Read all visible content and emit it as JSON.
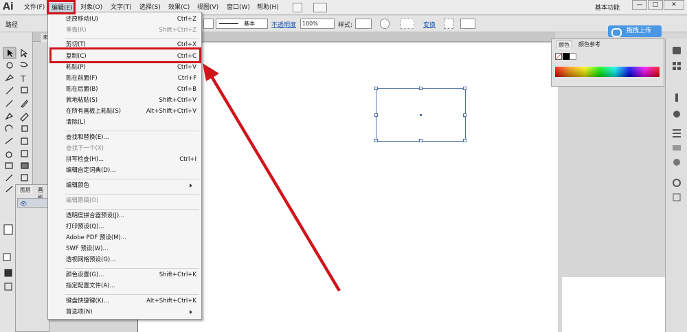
{
  "app": {
    "logo": "Ai"
  },
  "menubar": {
    "items": [
      "文件(F)",
      "编辑(E)",
      "对象(O)",
      "文字(T)",
      "选择(S)",
      "效果(C)",
      "视图(V)",
      "窗口(W)",
      "帮助(H)"
    ],
    "workspace": "基本功能",
    "window_buttons": [
      "—",
      "□",
      "✕"
    ]
  },
  "controlbar": {
    "label": "路径",
    "stroke_style": "基本",
    "opacity_link": "不透明度",
    "opacity_value": "100%",
    "style_label": "样式:",
    "transform_link": "变换"
  },
  "upload_button": "拖拽上传",
  "document": {
    "tab": "未"
  },
  "layers_panel": {
    "tabs": [
      "图层",
      "画板"
    ]
  },
  "color_panel": {
    "tabs": [
      "颜色",
      "颜色参考"
    ],
    "accent": "#4a97e5"
  },
  "edit_menu": {
    "items": [
      {
        "label": "还原移动(U)",
        "shortcut": "Ctrl+Z",
        "disabled": false
      },
      {
        "label": "重做(R)",
        "shortcut": "Shift+Ctrl+Z",
        "disabled": true
      },
      {
        "label": "剪切(T)",
        "shortcut": "Ctrl+X",
        "disabled": false
      },
      {
        "label": "复制(C)",
        "shortcut": "Ctrl+C",
        "disabled": false,
        "highlighted": true
      },
      {
        "label": "粘贴(P)",
        "shortcut": "Ctrl+V",
        "disabled": false
      },
      {
        "label": "贴在前面(F)",
        "shortcut": "Ctrl+F",
        "disabled": false
      },
      {
        "label": "贴在后面(B)",
        "shortcut": "Ctrl+B",
        "disabled": false
      },
      {
        "label": "就地粘贴(S)",
        "shortcut": "Shift+Ctrl+V",
        "disabled": false
      },
      {
        "label": "在所有画板上粘贴(S)",
        "shortcut": "Alt+Shift+Ctrl+V",
        "disabled": false
      },
      {
        "label": "清除(L)",
        "shortcut": "",
        "disabled": false
      },
      {
        "label": "查找和替换(E)...",
        "shortcut": "",
        "disabled": false
      },
      {
        "label": "查找下一个(X)",
        "shortcut": "",
        "disabled": true
      },
      {
        "label": "拼写检查(H)...",
        "shortcut": "Ctrl+I",
        "disabled": false
      },
      {
        "label": "编辑自定词典(D)...",
        "shortcut": "",
        "disabled": false
      },
      {
        "label": "编辑颜色",
        "shortcut": "",
        "disabled": false,
        "submenu": true
      },
      {
        "label": "编辑原稿(O)",
        "shortcut": "",
        "disabled": true
      },
      {
        "label": "透明度拼合器预设(J)...",
        "shortcut": "",
        "disabled": false
      },
      {
        "label": "打印预设(Q)...",
        "shortcut": "",
        "disabled": false
      },
      {
        "label": "Adobe PDF 预设(M)...",
        "shortcut": "",
        "disabled": false
      },
      {
        "label": "SWF 预设(W)...",
        "shortcut": "",
        "disabled": false
      },
      {
        "label": "透视网格预设(G)...",
        "shortcut": "",
        "disabled": false
      },
      {
        "label": "颜色设置(G)...",
        "shortcut": "Shift+Ctrl+K",
        "disabled": false
      },
      {
        "label": "指定配置文件(A)...",
        "shortcut": "",
        "disabled": false
      },
      {
        "label": "键盘快捷键(K)...",
        "shortcut": "Alt+Shift+Ctrl+K",
        "disabled": false
      },
      {
        "label": "首选项(N)",
        "shortcut": "",
        "disabled": false,
        "submenu": true
      }
    ]
  },
  "annotation": {
    "color": "#d1141c"
  }
}
